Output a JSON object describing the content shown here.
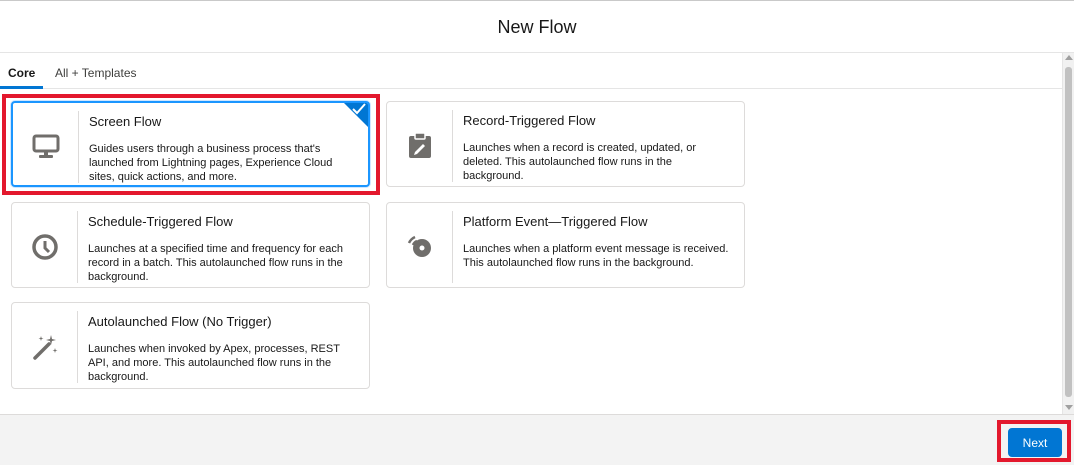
{
  "header": {
    "title": "New Flow"
  },
  "tabs": [
    {
      "label": "Core",
      "active": true
    },
    {
      "label": "All + Templates",
      "active": false
    }
  ],
  "cards": [
    {
      "title": "Screen Flow",
      "description": "Guides users through a business process that's launched from Lightning pages, Experience Cloud sites, quick actions, and more.",
      "icon": "monitor-icon",
      "selected": true
    },
    {
      "title": "Record-Triggered Flow",
      "description": "Launches when a record is created, updated, or deleted. This autolaunched flow runs in the background.",
      "icon": "clipboard-edit-icon",
      "selected": false
    },
    {
      "title": "Schedule-Triggered Flow",
      "description": "Launches at a specified time and frequency for each record in a batch. This autolaunched flow runs in the background.",
      "icon": "clock-icon",
      "selected": false
    },
    {
      "title": "Platform Event—Triggered Flow",
      "description": "Launches when a platform event message is received. This autolaunched flow runs in the background.",
      "icon": "broadcast-icon",
      "selected": false
    },
    {
      "title": "Autolaunched Flow (No Trigger)",
      "description": "Launches when invoked by Apex, processes, REST API, and more. This autolaunched flow runs in the background.",
      "icon": "magic-wand-icon",
      "selected": false
    }
  ],
  "footer": {
    "next_label": "Next"
  },
  "colors": {
    "brand": "#0176d3",
    "highlight": "#e3182d",
    "icon": "#706e6b"
  }
}
